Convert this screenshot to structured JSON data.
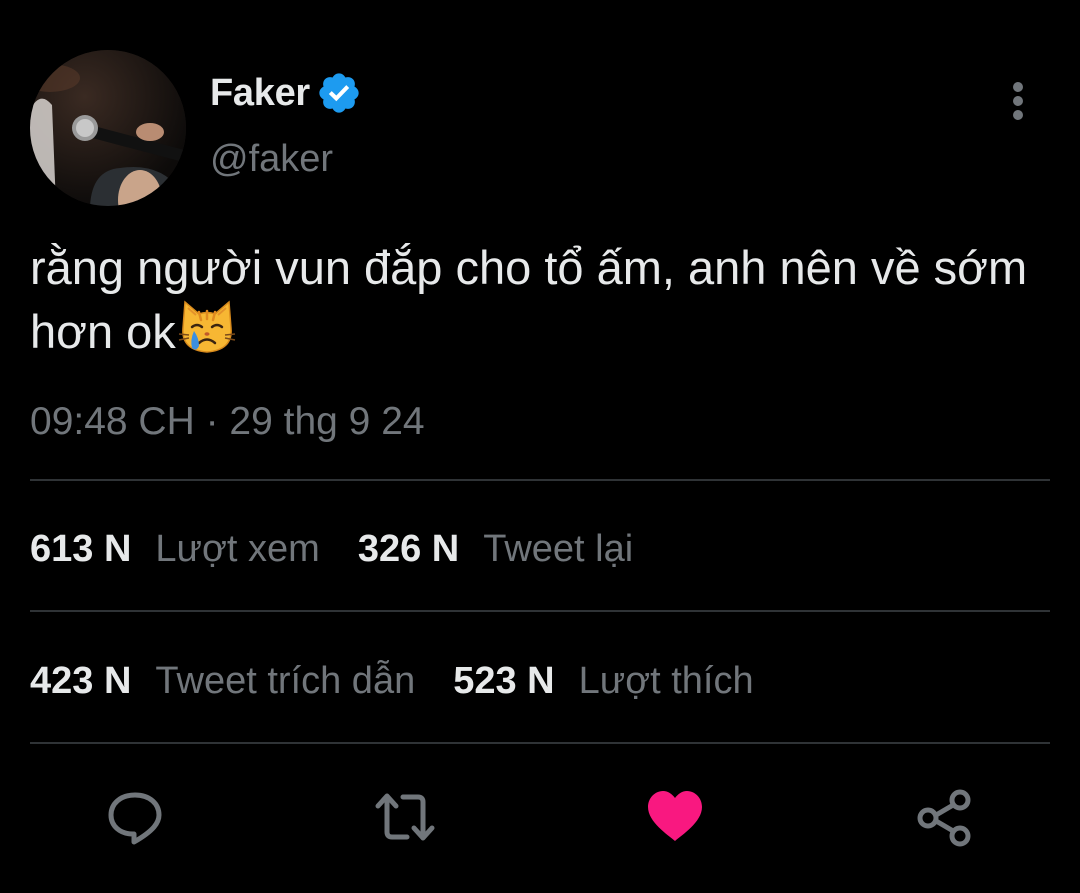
{
  "author": {
    "display_name": "Faker",
    "handle": "@faker",
    "verified": true
  },
  "tweet": {
    "text": "rằng người vun đắp cho tổ ấm, anh nên về sớm hơn ok",
    "emoji": "crying-cat-face",
    "timestamp": "09:48 CH · 29 thg 9 24"
  },
  "stats": {
    "views": {
      "count": "613 N",
      "label": "Lượt xem"
    },
    "retweets": {
      "count": "326 N",
      "label": "Tweet lại"
    },
    "quotes": {
      "count": "423 N",
      "label": "Tweet trích dẫn"
    },
    "likes": {
      "count": "523 N",
      "label": "Lượt thích"
    }
  },
  "actions": {
    "reply": "comment-icon",
    "retweet": "retweet-icon",
    "like": "heart-icon",
    "share": "share-icon"
  },
  "colors": {
    "background": "#000000",
    "text_primary": "#e7e9ea",
    "text_secondary": "#71767b",
    "divider": "#2f3336",
    "verified_blue": "#1d9bf0",
    "like_red": "#f91880"
  }
}
